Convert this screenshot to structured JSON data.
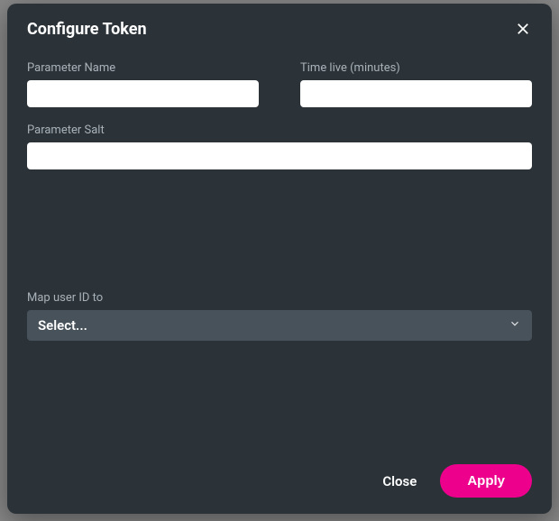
{
  "modal": {
    "title": "Configure Token",
    "fields": {
      "parameter_name": {
        "label": "Parameter Name",
        "value": ""
      },
      "time_live": {
        "label": "Time live (minutes)",
        "value": ""
      },
      "parameter_salt": {
        "label": "Parameter Salt",
        "value": ""
      },
      "map_user_id": {
        "label": "Map user ID to",
        "selected": "Select..."
      }
    },
    "footer": {
      "close": "Close",
      "apply": "Apply"
    }
  }
}
